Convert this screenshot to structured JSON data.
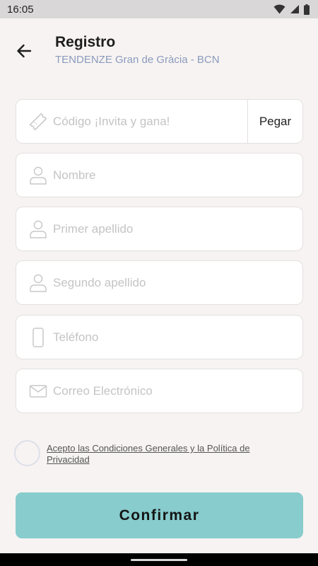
{
  "status_bar": {
    "time": "16:05"
  },
  "header": {
    "title": "Registro",
    "subtitle": "TENDENZE Gran de Gràcia - BCN"
  },
  "form": {
    "invite_code": {
      "placeholder": "Código ¡Invita y gana!",
      "value": "",
      "paste_label": "Pegar"
    },
    "first_name": {
      "placeholder": "Nombre",
      "value": ""
    },
    "first_surname": {
      "placeholder": "Primer apellido",
      "value": ""
    },
    "second_surname": {
      "placeholder": "Segundo apellido",
      "value": ""
    },
    "phone": {
      "placeholder": "Teléfono",
      "value": ""
    },
    "email": {
      "placeholder": "Correo Electrónico",
      "value": ""
    }
  },
  "terms": {
    "label": "Acepto las Condiciones Generales y la Política de Privacidad",
    "checked": false
  },
  "confirm_button": {
    "label": "Confirmar"
  },
  "icons": {
    "back": "arrow-left-icon",
    "invite": "ticket-icon",
    "person": "person-icon",
    "phone": "smartphone-icon",
    "email": "envelope-icon"
  },
  "colors": {
    "background": "#f7f3f2",
    "accent": "#88cccd",
    "subtitle": "#8a9bbd",
    "placeholder": "#c4c4c4"
  }
}
